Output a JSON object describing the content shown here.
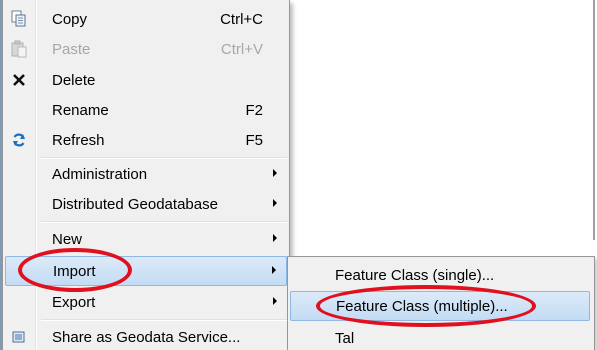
{
  "context_menu": {
    "items": [
      {
        "label": "Copy",
        "shortcut": "Ctrl+C",
        "icon": "copy-icon"
      },
      {
        "label": "Paste",
        "shortcut": "Ctrl+V",
        "icon": "paste-icon",
        "disabled": true
      },
      {
        "label": "Delete",
        "icon": "delete-icon"
      },
      {
        "label": "Rename",
        "shortcut": "F2"
      },
      {
        "label": "Refresh",
        "shortcut": "F5",
        "icon": "refresh-icon"
      },
      {
        "label": "Administration",
        "submenu": true
      },
      {
        "label": "Distributed Geodatabase",
        "submenu": true
      },
      {
        "label": "New",
        "submenu": true
      },
      {
        "label": "Import",
        "submenu": true,
        "highlighted": true
      },
      {
        "label": "Export",
        "submenu": true
      },
      {
        "label": "Share as Geodata Service...",
        "icon": "share-icon"
      }
    ]
  },
  "import_submenu": {
    "items": [
      {
        "label": "Feature Class (single)..."
      },
      {
        "label": "Feature Class (multiple)...",
        "highlighted": true
      },
      {
        "label": "Tal"
      }
    ]
  },
  "annotation_color": "#e0101e",
  "highlight_color": "#c3dcf4"
}
